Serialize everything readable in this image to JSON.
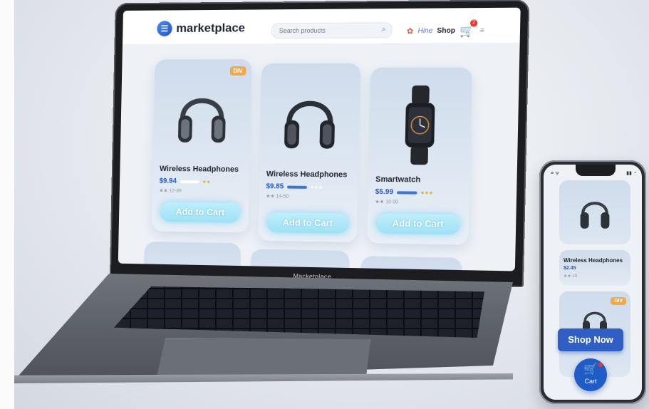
{
  "app": {
    "logo_text": "marketplace",
    "chin_label": "Macketplace"
  },
  "header": {
    "search_placeholder": "Search products",
    "hire_label": "Hine",
    "shop_label": "Shop",
    "cart_count": "2"
  },
  "products": [
    {
      "title": "Wireless Headphones",
      "price": "$9.94",
      "rating": "★★ 12-30",
      "cta": "Add to Cart",
      "badge": "DIV"
    },
    {
      "title": "Wireless Headphones",
      "price": "$9.85",
      "rating": "★★ 14-50",
      "cta": "Add to Cart",
      "badge": ""
    },
    {
      "title": "Smartwatch",
      "price": "$5.99",
      "rating": "★★ 10 00",
      "cta": "Add to Cart",
      "badge": ""
    }
  ],
  "phone": {
    "card_title": "Wireless Headphones",
    "card_price": "$2.45",
    "card_rating": "★★ 10",
    "badge": "DIV",
    "shop_now": "Shop Now",
    "cart_label": "Cart"
  },
  "colors": {
    "accent": "#2459c7",
    "cta": "#9fe0f5",
    "badge": "#f2a94a",
    "cart": "#1f5cc8"
  }
}
